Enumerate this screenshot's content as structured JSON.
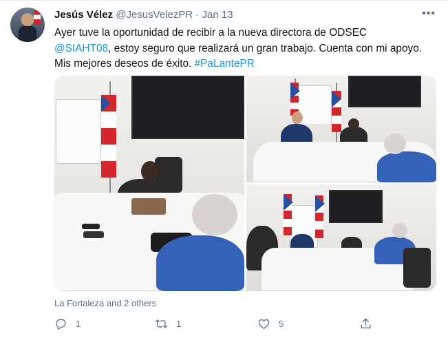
{
  "tweet": {
    "author_name": "Jesús Vélez",
    "handle": "@JesusVelezPR",
    "separator": "·",
    "date": "Jan 13",
    "more_label": "•••",
    "text_part1": "Ayer tuve la oportunidad de recibir a la nueva directora de ODSEC ",
    "mention": "@SIAHT08",
    "text_part2": ", estoy seguro que realizará un gran trabajo. Cuenta con mi apoyo. Mis mejores deseos de éxito. ",
    "hashtag": "#PaLantePR",
    "location": "La Fortaleza and 2 others"
  },
  "actions": {
    "reply_count": "1",
    "retweet_count": "1",
    "like_count": "5"
  },
  "icons": {
    "reply": "reply-icon",
    "retweet": "retweet-icon",
    "like": "heart-icon",
    "share": "share-icon"
  },
  "colors": {
    "link": "#1b95e0",
    "secondary": "#5b7083"
  }
}
